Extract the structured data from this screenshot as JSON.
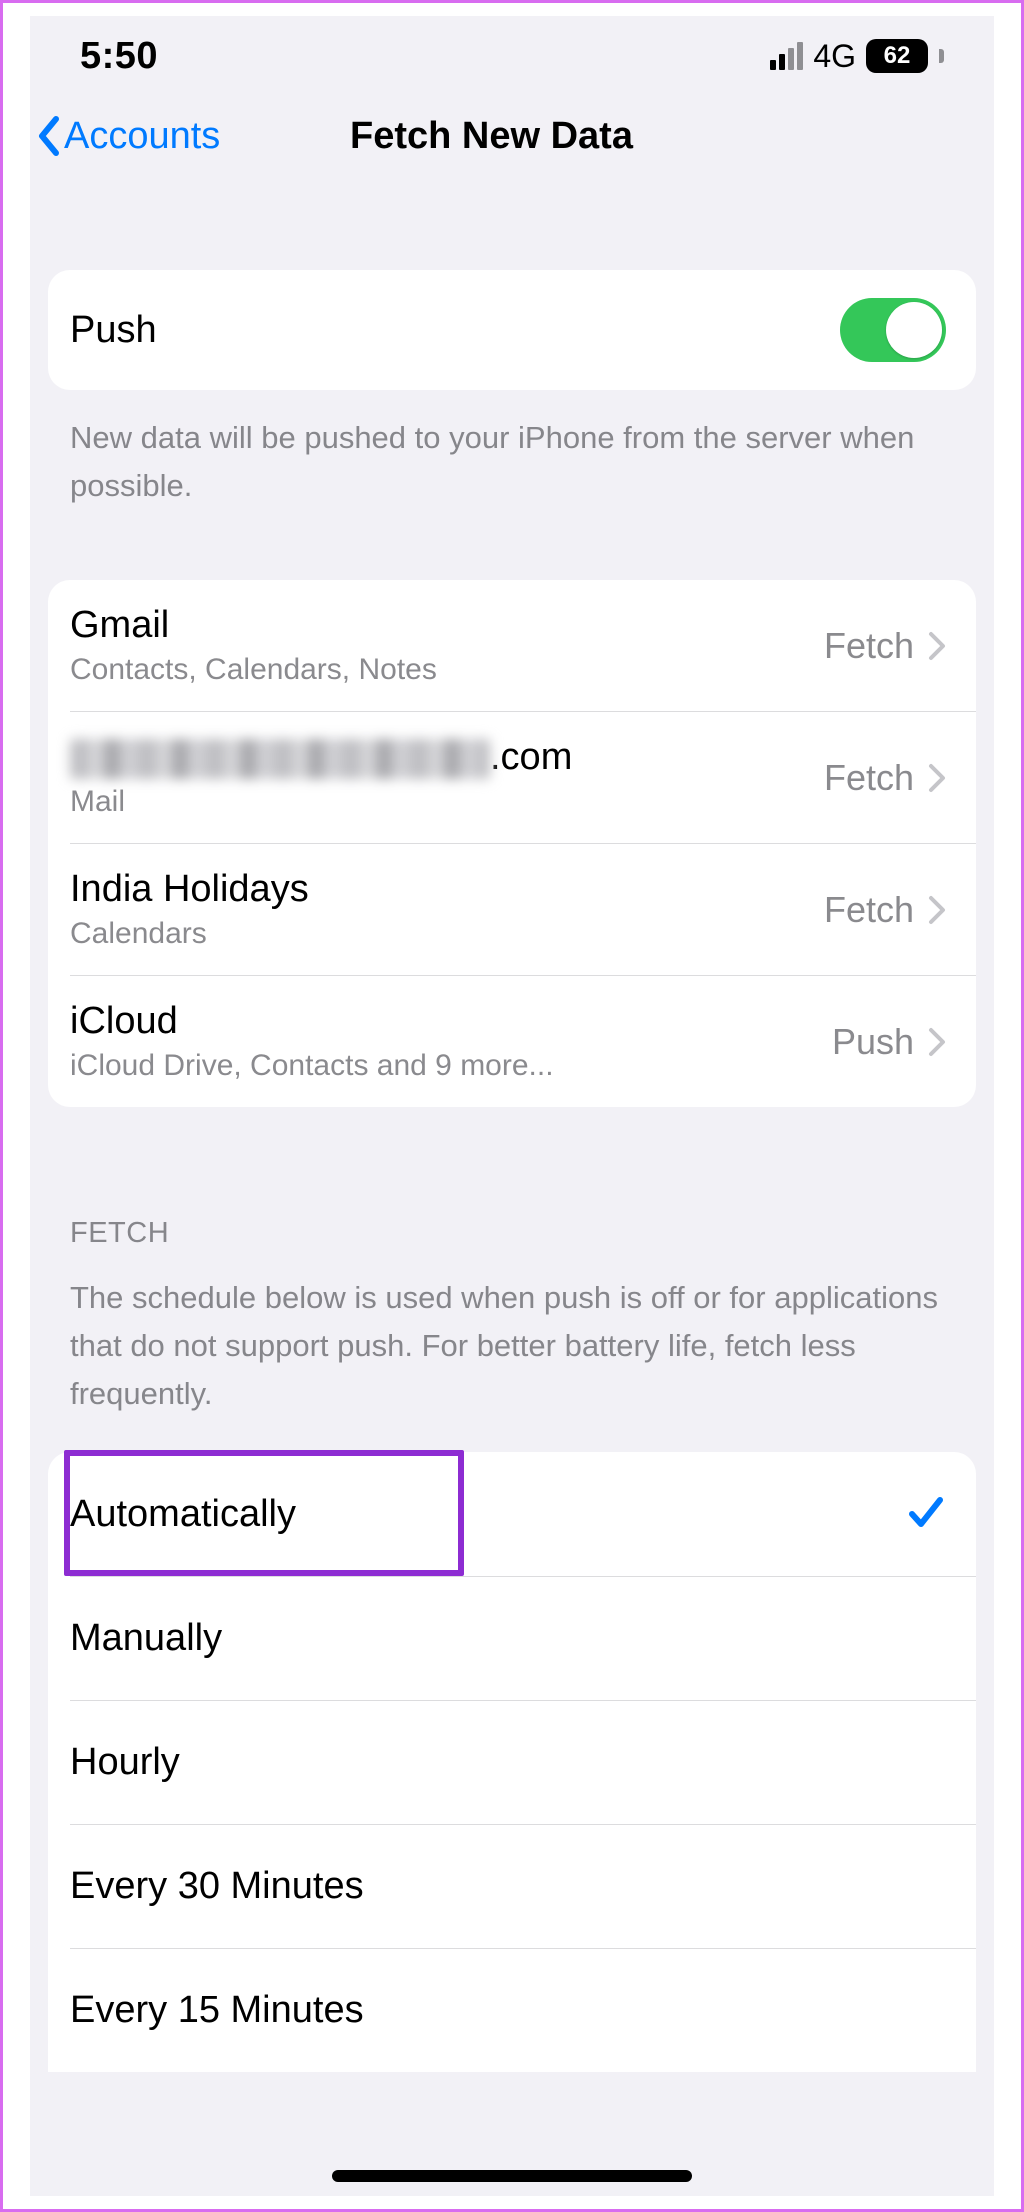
{
  "statusbar": {
    "time": "5:50",
    "network_label": "4G",
    "battery_pct": "62"
  },
  "nav": {
    "back_label": "Accounts",
    "title": "Fetch New Data"
  },
  "push_row": {
    "label": "Push",
    "on": true,
    "footer": "New data will be pushed to your iPhone from the server when possible."
  },
  "accounts": [
    {
      "title": "Gmail",
      "subtitle": "Contacts, Calendars, Notes",
      "mode": "Fetch",
      "redacted": false
    },
    {
      "title_suffix": ".com",
      "subtitle": "Mail",
      "mode": "Fetch",
      "redacted": true
    },
    {
      "title": "India Holidays",
      "subtitle": "Calendars",
      "mode": "Fetch",
      "redacted": false
    },
    {
      "title": "iCloud",
      "subtitle": "iCloud Drive, Contacts and 9 more...",
      "mode": "Push",
      "redacted": false
    }
  ],
  "fetch_section": {
    "header": "FETCH",
    "description": "The schedule below is used when push is off or for applications that do not support push. For better battery life, fetch less frequently.",
    "options": [
      {
        "label": "Automatically",
        "selected": true
      },
      {
        "label": "Manually",
        "selected": false
      },
      {
        "label": "Hourly",
        "selected": false
      },
      {
        "label": "Every 30 Minutes",
        "selected": false
      },
      {
        "label": "Every 15 Minutes",
        "selected": false
      }
    ]
  }
}
